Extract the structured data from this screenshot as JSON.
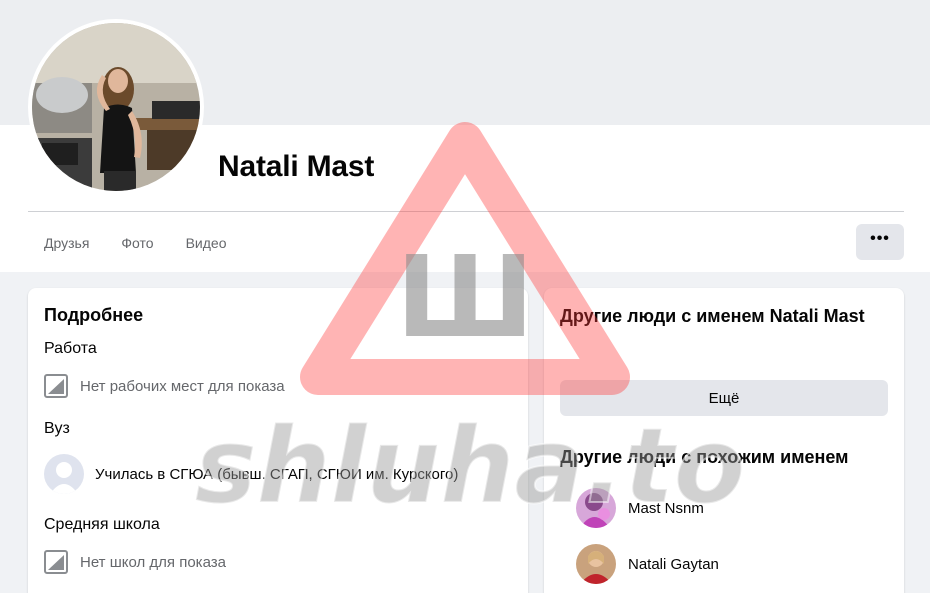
{
  "profile": {
    "name": "Natali Mast"
  },
  "tabs": [
    {
      "label": "Друзья"
    },
    {
      "label": "Фото"
    },
    {
      "label": "Видео"
    }
  ],
  "more_button": {
    "label": "•••",
    "icon": "more-dots-icon"
  },
  "details": {
    "title": "Подробнее",
    "work": {
      "heading": "Работа",
      "text": "Нет рабочих мест для показа"
    },
    "university": {
      "heading": "Вуз",
      "prefix": "Училась в ",
      "school": "СГЮА (бывш. СГАП, СГЮИ им. Курского)"
    },
    "high_school": {
      "heading": "Средняя школа",
      "text": "Нет школ для показа"
    }
  },
  "others_same_name": {
    "title": "Другие люди с именем Natali Mast",
    "more_label": "Ещё"
  },
  "others_similar": {
    "title": "Другие люди с похожим именем",
    "people": [
      {
        "name": "Mast Nsnm"
      },
      {
        "name": "Natali Gaytan"
      }
    ]
  },
  "watermark": {
    "text": "shluha.to",
    "letter": "Ш",
    "color": "#ff3b3b"
  }
}
